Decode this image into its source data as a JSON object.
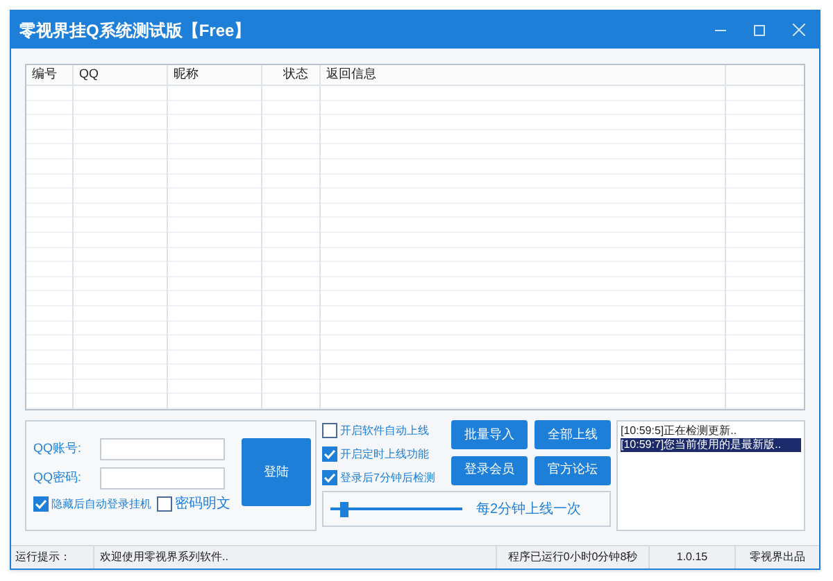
{
  "window": {
    "title": "零视界挂Q系统测试版【Free】"
  },
  "table": {
    "columns": [
      "编号",
      "QQ",
      "昵称",
      "状态",
      "返回信息"
    ]
  },
  "login": {
    "account_label": "QQ账号:",
    "password_label": "QQ密码:",
    "login_button": "登陆",
    "options": [
      {
        "label": "隐藏后自动登录挂机",
        "checked": true
      },
      {
        "label": "密码明文",
        "checked": false
      }
    ]
  },
  "settings": [
    {
      "label": "开启软件自动上线",
      "checked": false
    },
    {
      "label": "开启定时上线功能",
      "checked": true
    },
    {
      "label": "登录后7分钟后检测",
      "checked": true
    }
  ],
  "buttons": [
    "批量导入",
    "全部上线",
    "登录会员",
    "官方论坛"
  ],
  "interval": {
    "level": 0.08,
    "reading": "每2分钟上线一次"
  },
  "log": [
    {
      "text": "[10:59:5]正在检测更新..",
      "selected": false
    },
    {
      "text": "[10:59:7]您当前使用的是最新版..",
      "selected": true
    }
  ],
  "status_bar": {
    "label": "运行提示：",
    "message": "欢迎使用零视界系列软件..",
    "runtime": "程序已运行0小时0分钟8秒",
    "version": "1.0.15",
    "credit": "零视界出品"
  }
}
